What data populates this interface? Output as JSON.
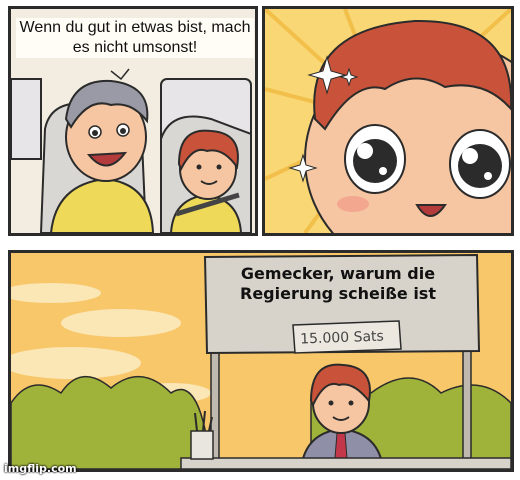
{
  "meme": {
    "panel1_caption": "Wenn du gut in etwas bist, mach es nicht umsonst!",
    "sign_text": "Gemecker, warum die Regierung scheiße ist",
    "price_text": "15.000 Sats",
    "watermark": "imgflip.com"
  },
  "colors": {
    "sky": "#f7c76a",
    "sparkle_bg": "#f8d774",
    "hair_kid": "#c9533a",
    "hair_dad": "#9a9aa6",
    "shirt_dad": "#eeda58",
    "bush": "#9fb33a",
    "sign": "#d7d3cb",
    "outline": "#2b2b2b"
  },
  "icons": [
    "sparkle-icon",
    "kid-face",
    "dad-face",
    "lemonade-stand-sign",
    "pencil-cup"
  ]
}
